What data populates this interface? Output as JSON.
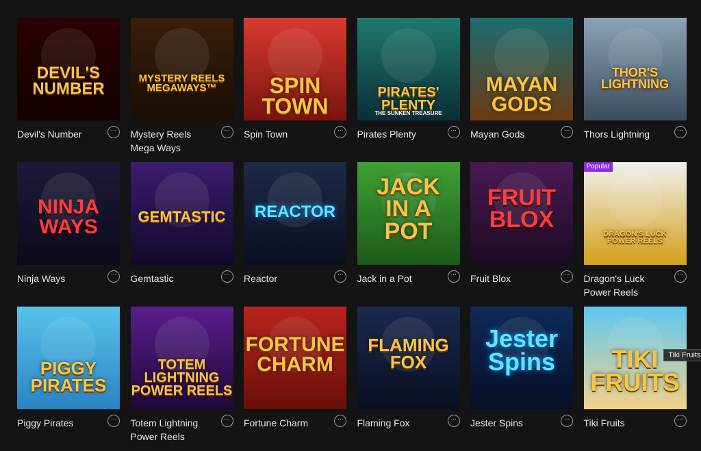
{
  "games": [
    {
      "name": "Devil's Number",
      "logo": "DEVIL'S\nNUMBER",
      "bg1": "#2a0303",
      "bg2": "#120000",
      "logo_color": "gold"
    },
    {
      "name": "Mystery Reels\nMega Ways",
      "logo": "MYSTERY REELS\nMEGAWAYS™",
      "bg1": "#3b1f0a",
      "bg2": "#1a0d04",
      "logo_color": "gold"
    },
    {
      "name": "Spin Town",
      "logo": "SPIN\nTOWN",
      "bg1": "#d93a2e",
      "bg2": "#7a1410",
      "logo_color": "gold"
    },
    {
      "name": "Pirates Plenty",
      "logo": "PIRATES'\nPLENTY",
      "sub": "THE SUNKEN TREASURE",
      "bg1": "#1f7a6e",
      "bg2": "#0a2e36",
      "logo_color": "gold"
    },
    {
      "name": "Mayan Gods",
      "logo": "MAYAN\nGODS",
      "bg1": "#1b6d72",
      "bg2": "#6b3a12",
      "logo_color": "gold"
    },
    {
      "name": "Thors Lightning",
      "logo": "THOR'S\nLIGHTNING",
      "bg1": "#8aa3b8",
      "bg2": "#3b4d5e",
      "logo_color": "gold"
    },
    {
      "name": "Ninja Ways",
      "logo": "NINJA\nWAYS",
      "bg1": "#1c1a3a",
      "bg2": "#0b0a1a",
      "logo_color": "red"
    },
    {
      "name": "Gemtastic",
      "logo": "GEMTASTIC",
      "bg1": "#3a1e6e",
      "bg2": "#12082a",
      "logo_color": "gold"
    },
    {
      "name": "Reactor",
      "logo": "REACTOR",
      "bg1": "#1e2a4a",
      "bg2": "#0a0f1f",
      "logo_color": "cyan"
    },
    {
      "name": "Jack in a Pot",
      "logo": "JACK\nIN A\nPOT",
      "bg1": "#3fa035",
      "bg2": "#1d5a1a",
      "logo_color": "gold"
    },
    {
      "name": "Fruit Blox",
      "logo": "FRUIT\nBLOX",
      "bg1": "#4a1a55",
      "bg2": "#1c0a22",
      "logo_color": "red"
    },
    {
      "name": "Dragon's Luck\nPower Reels",
      "logo": "DRAGON'S LUCK\nPOWER REELS",
      "bg1": "#f0f0f0",
      "bg2": "#d4a017",
      "logo_color": "gold",
      "badge": "Popular"
    },
    {
      "name": "Piggy Pirates",
      "logo": "PIGGY\nPIRATES",
      "bg1": "#57c3ea",
      "bg2": "#2a84c2",
      "logo_color": "gold"
    },
    {
      "name": "Totem Lightning\nPower Reels",
      "logo": "TOTEM\nLIGHTNING\nPOWER REELS",
      "bg1": "#5a1e8c",
      "bg2": "#1e0838",
      "logo_color": "gold"
    },
    {
      "name": "Fortune Charm",
      "logo": "FORTUNE\nCHARM",
      "bg1": "#b8241c",
      "bg2": "#6a0f0b",
      "logo_color": "gold"
    },
    {
      "name": "Flaming Fox",
      "logo": "FLAMING\nFOX",
      "bg1": "#1a2a4e",
      "bg2": "#0a0f22",
      "logo_color": "gold"
    },
    {
      "name": "Jester Spins",
      "logo": "Jester\nSpins",
      "bg1": "#102a5a",
      "bg2": "#060f26",
      "logo_color": "cyan"
    },
    {
      "name": "Tiki Fruits",
      "logo": "TIKI\nFRUITS",
      "bg1": "#5ec7f2",
      "bg2": "#f2d28a",
      "logo_color": "gold",
      "tooltip": "Tiki Fruits"
    }
  ],
  "more_icon": "ellipsis-circle-icon",
  "more_symbol": "···"
}
